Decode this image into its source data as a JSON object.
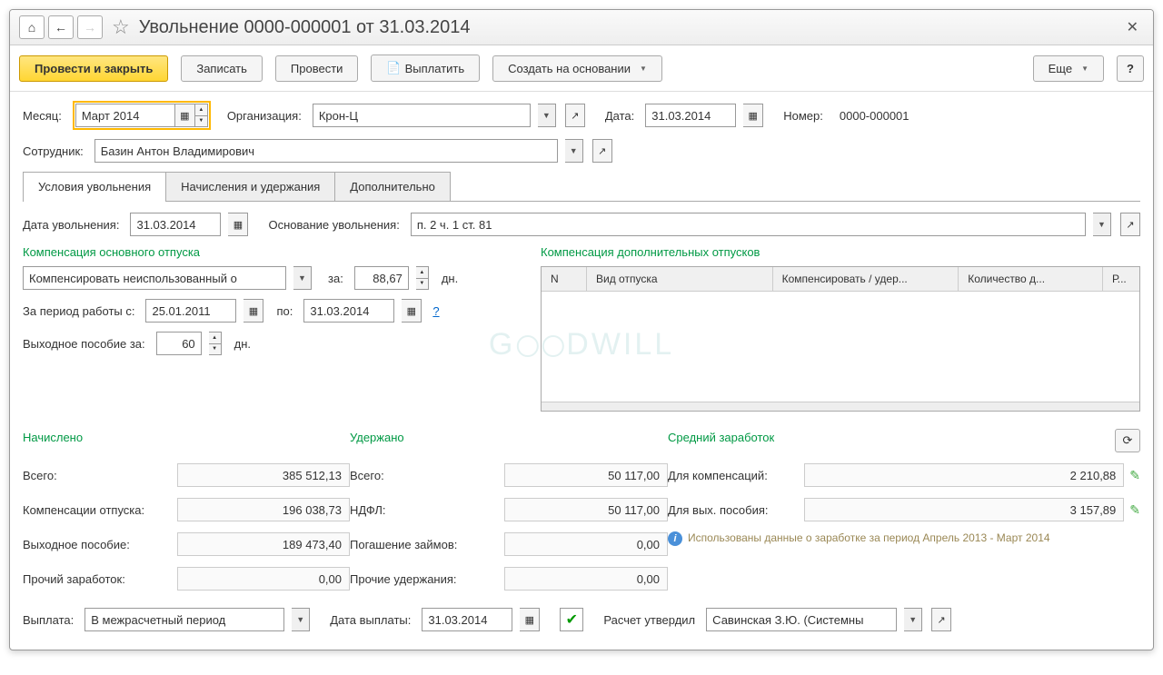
{
  "title": "Увольнение 0000-000001 от 31.03.2014",
  "toolbar": {
    "post_close": "Провести и закрыть",
    "write": "Записать",
    "post": "Провести",
    "pay": "Выплатить",
    "create_based": "Создать на основании",
    "more": "Еще"
  },
  "header": {
    "month_lbl": "Месяц:",
    "month": "Март 2014",
    "org_lbl": "Организация:",
    "org": "Крон-Ц",
    "date_lbl": "Дата:",
    "date": "31.03.2014",
    "num_lbl": "Номер:",
    "num": "0000-000001",
    "emp_lbl": "Сотрудник:",
    "emp": "Базин Антон Владимирович"
  },
  "tabs": {
    "t1": "Условия увольнения",
    "t2": "Начисления и удержания",
    "t3": "Дополнительно"
  },
  "dismissal": {
    "date_lbl": "Дата увольнения:",
    "date": "31.03.2014",
    "reason_lbl": "Основание увольнения:",
    "reason": "п. 2 ч. 1 ст. 81",
    "comp_main_lbl": "Компенсация основного отпуска",
    "comp_type": "Компенсировать неиспользованный о",
    "for_lbl": "за:",
    "days": "88,67",
    "days_lbl": "дн.",
    "period_lbl": "За период работы с:",
    "period_from": "25.01.2011",
    "po_lbl": "по:",
    "period_to": "31.03.2014",
    "severance_lbl": "Выходное пособие за:",
    "severance_days": "60",
    "comp_add_lbl": "Компенсация дополнительных отпусков",
    "table": {
      "h1": "N",
      "h2": "Вид отпуска",
      "h3": "Компенсировать / удер...",
      "h4": "Количество д...",
      "h5": "Р..."
    }
  },
  "summary": {
    "accrued_lbl": "Начислено",
    "withheld_lbl": "Удержано",
    "avg_lbl": "Средний заработок",
    "total_lbl": "Всего:",
    "accrued_total": "385 512,13",
    "comp_lbl": "Компенсации отпуска:",
    "comp_val": "196 038,73",
    "sev_lbl": "Выходное пособие:",
    "sev_val": "189 473,40",
    "other_lbl": "Прочий заработок:",
    "other_val": "0,00",
    "withheld_total": "50 117,00",
    "ndfl_lbl": "НДФЛ:",
    "ndfl_val": "50 117,00",
    "loan_lbl": "Погашение займов:",
    "loan_val": "0,00",
    "other_w_lbl": "Прочие удержания:",
    "other_w_val": "0,00",
    "for_comp_lbl": "Для компенсаций:",
    "for_comp_val": "2 210,88",
    "for_sev_lbl": "Для вых. пособия:",
    "for_sev_val": "3 157,89",
    "info": "Использованы данные о заработке за период Апрель 2013 - Март 2014"
  },
  "footer": {
    "payment_lbl": "Выплата:",
    "payment": "В межрасчетный период",
    "pay_date_lbl": "Дата выплаты:",
    "pay_date": "31.03.2014",
    "approved_lbl": "Расчет утвердил",
    "approved": "Савинская З.Ю. (Системны"
  },
  "watermark": "G   ODWILL"
}
